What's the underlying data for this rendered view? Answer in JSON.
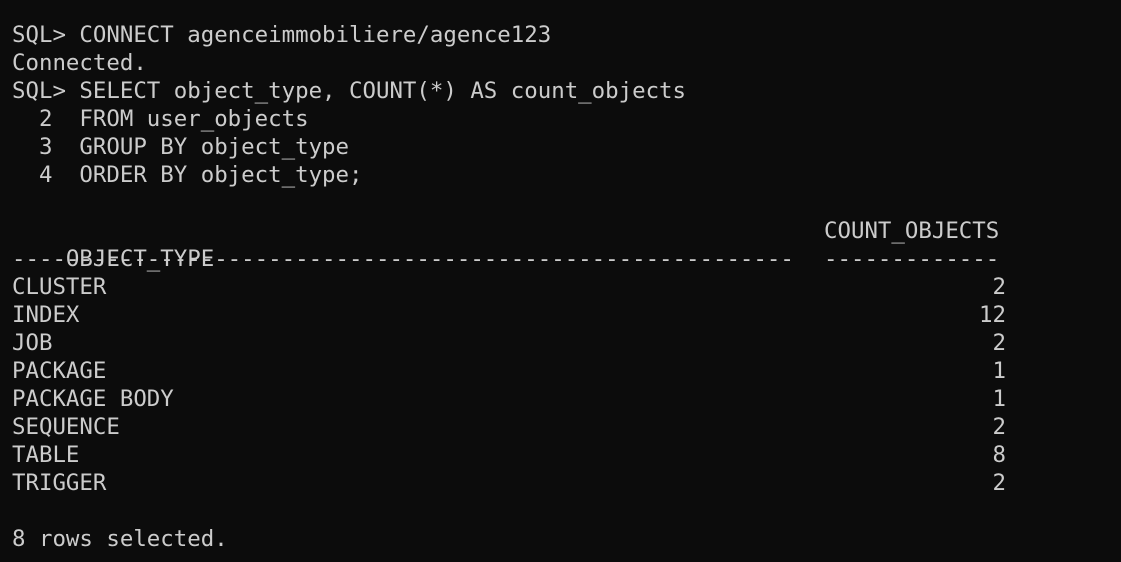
{
  "session": {
    "connect_prompt": "SQL> ",
    "connect_cmd": "CONNECT agenceimmobiliere/agence123",
    "connected_msg": "Connected.",
    "query_lines": [
      "SQL> SELECT object_type, COUNT(*) AS count_objects",
      "  2  FROM user_objects",
      "  3  GROUP BY object_type",
      "  4  ORDER BY object_type;"
    ]
  },
  "result": {
    "headers": [
      "OBJECT_TYPE",
      "COUNT_OBJECTS"
    ],
    "separator_left": "----------------------------------------------------------",
    "separator_right": "-------------",
    "rows": [
      {
        "type": "CLUSTER",
        "count": "2"
      },
      {
        "type": "INDEX",
        "count": "12"
      },
      {
        "type": "JOB",
        "count": "2"
      },
      {
        "type": "PACKAGE",
        "count": "1"
      },
      {
        "type": "PACKAGE BODY",
        "count": "1"
      },
      {
        "type": "SEQUENCE",
        "count": "2"
      },
      {
        "type": "TABLE",
        "count": "8"
      },
      {
        "type": "TRIGGER",
        "count": "2"
      }
    ],
    "footer": "8 rows selected."
  },
  "colors": {
    "background": "#0c0c0c",
    "text": "#cccccc"
  }
}
